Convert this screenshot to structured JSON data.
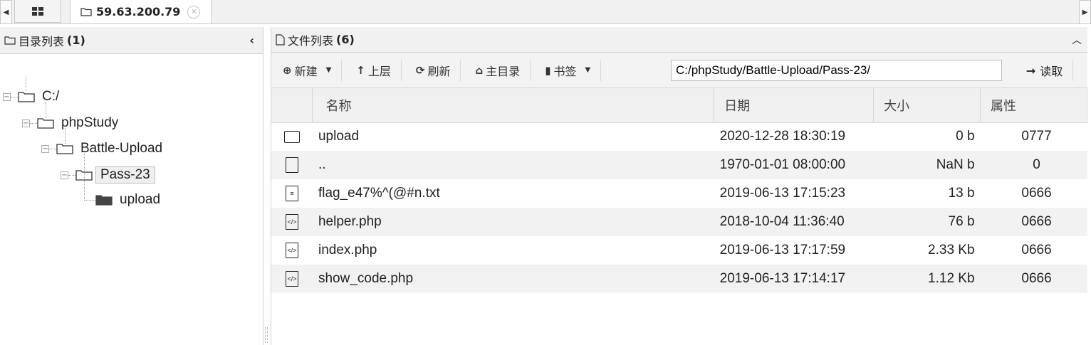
{
  "tabs": {
    "home_icon": "grid-icon",
    "active": {
      "icon": "folder-outline-icon",
      "label": "59.63.200.79"
    }
  },
  "left_panel": {
    "title": "目录列表",
    "count": "(1)",
    "tree": [
      {
        "name": "C:/"
      },
      {
        "name": "phpStudy"
      },
      {
        "name": "Battle-Upload"
      },
      {
        "name": "Pass-23"
      },
      {
        "name": "upload"
      }
    ]
  },
  "right_panel": {
    "title": "文件列表",
    "count": "(6)",
    "toolbar": {
      "new": "新建",
      "up": "上层",
      "refresh": "刷新",
      "home": "主目录",
      "bookmark": "书签",
      "path": "C:/phpStudy/Battle-Upload/Pass-23/",
      "read": "读取"
    },
    "columns": {
      "name": "名称",
      "date": "日期",
      "size": "大小",
      "perm": "属性"
    },
    "files": [
      {
        "icon": "folder-icon",
        "name": "upload",
        "date": "2020-12-28 18:30:19",
        "size": "0 b",
        "perm": "0777"
      },
      {
        "icon": "file-icon",
        "name": "..",
        "date": "1970-01-01 08:00:00",
        "size": "NaN b",
        "perm": "0"
      },
      {
        "icon": "text-file-icon",
        "name": "flag_e47%^(@#n.txt",
        "date": "2019-06-13 17:15:23",
        "size": "13 b",
        "perm": "0666"
      },
      {
        "icon": "code-file-icon",
        "name": "helper.php",
        "date": "2018-10-04 11:36:40",
        "size": "76 b",
        "perm": "0666"
      },
      {
        "icon": "code-file-icon",
        "name": "index.php",
        "date": "2019-06-13 17:17:59",
        "size": "2.33 Kb",
        "perm": "0666"
      },
      {
        "icon": "code-file-icon",
        "name": "show_code.php",
        "date": "2019-06-13 17:14:17",
        "size": "1.12 Kb",
        "perm": "0666"
      }
    ]
  }
}
